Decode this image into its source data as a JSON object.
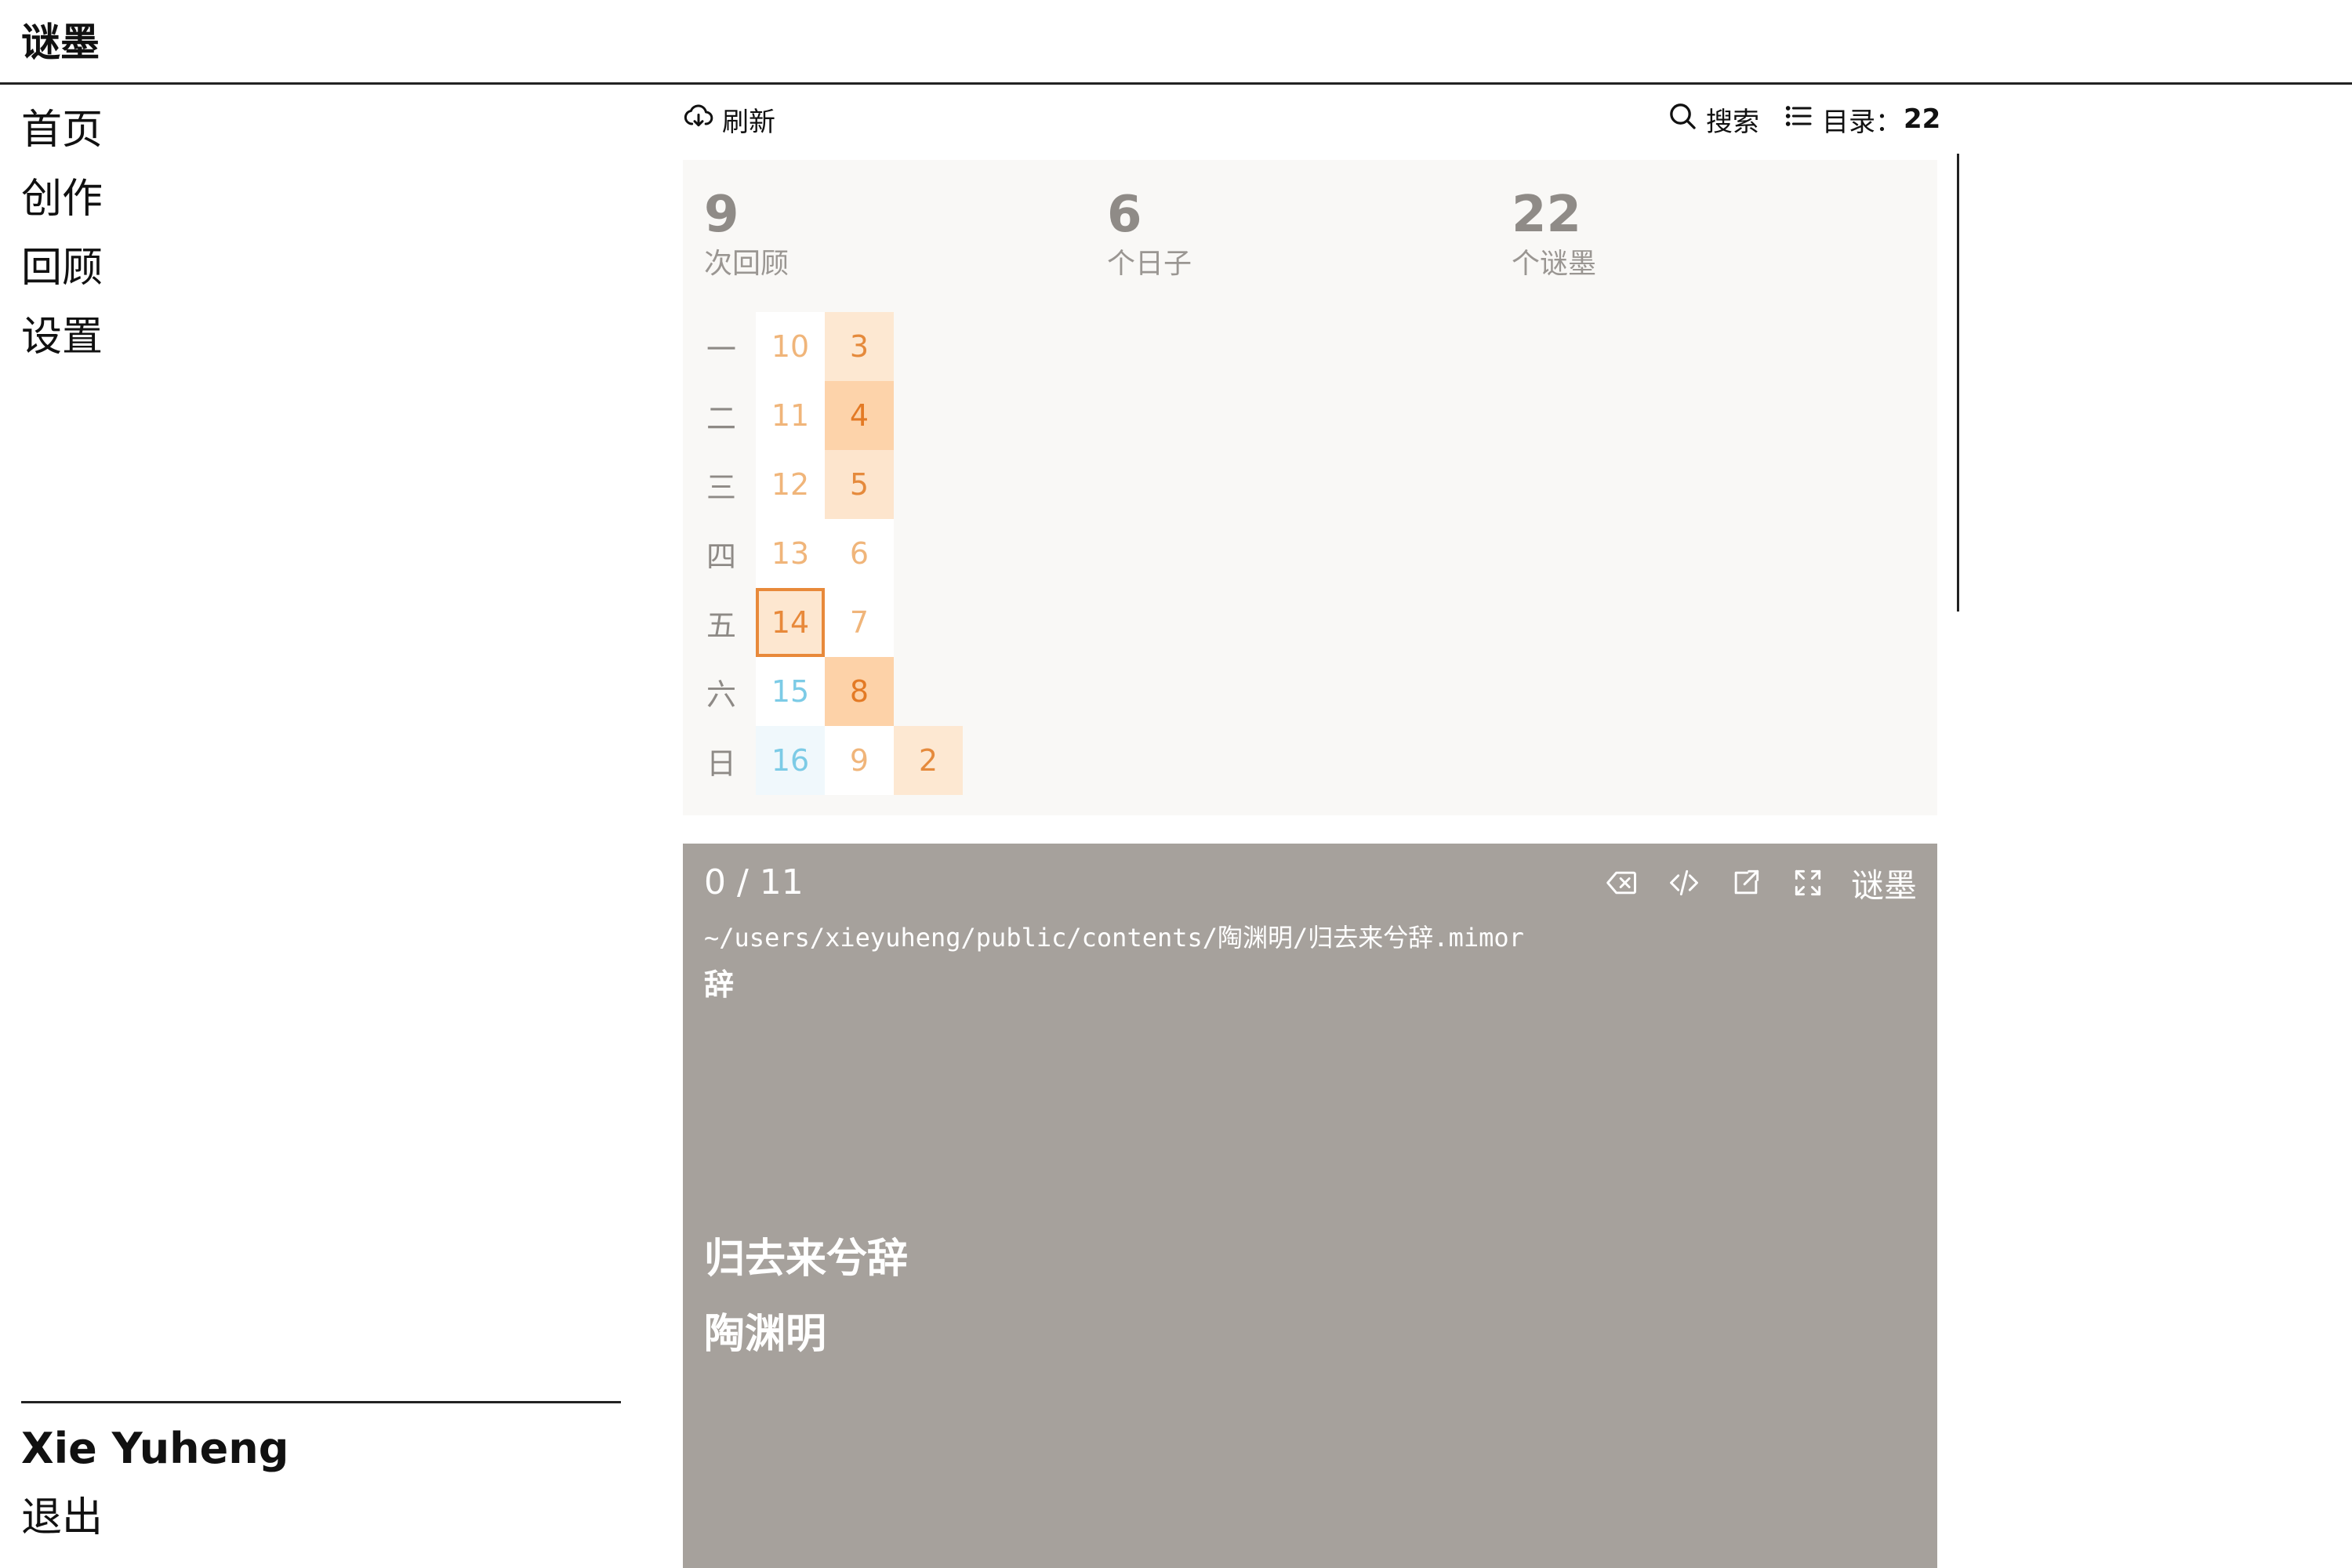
{
  "app": {
    "title": "谜墨"
  },
  "sidebar": {
    "nav": [
      {
        "label": "首页"
      },
      {
        "label": "创作"
      },
      {
        "label": "回顾"
      },
      {
        "label": "设置"
      }
    ],
    "user_name": "Xie Yuheng",
    "logout_label": "退出"
  },
  "toolbar": {
    "refresh_label": "刷新",
    "search_label": "搜索",
    "toc_label": "目录：",
    "toc_count": "22"
  },
  "stats": [
    {
      "value": "9",
      "label": "次回顾"
    },
    {
      "value": "6",
      "label": "个日子"
    },
    {
      "value": "22",
      "label": "个谜墨"
    }
  ],
  "calendar": {
    "weekdays": [
      "一",
      "二",
      "三",
      "四",
      "五",
      "六",
      "日"
    ],
    "columns": [
      {
        "cells": [
          {
            "day": "10",
            "level": 0,
            "text_color": "#f0b57a",
            "bg": "#ffffff"
          },
          {
            "day": "11",
            "level": 0,
            "text_color": "#f0b57a",
            "bg": "#ffffff"
          },
          {
            "day": "12",
            "level": 0,
            "text_color": "#f0b57a",
            "bg": "#ffffff"
          },
          {
            "day": "13",
            "level": 0,
            "text_color": "#f0b57a",
            "bg": "#ffffff"
          },
          {
            "day": "14",
            "level": 1,
            "text_color": "#e8893a",
            "bg": "#fde7d0",
            "today": true
          },
          {
            "day": "15",
            "level": 0,
            "text_color": "#7ccbe6",
            "bg": "#ffffff"
          },
          {
            "day": "16",
            "level": 0,
            "text_color": "#7ccbe6",
            "bg": "#f0f8fc"
          }
        ]
      },
      {
        "cells": [
          {
            "day": "3",
            "level": 1,
            "text_color": "#e58a3c",
            "bg": "#fde8d2"
          },
          {
            "day": "4",
            "level": 2,
            "text_color": "#e37a25",
            "bg": "#fdd3aa"
          },
          {
            "day": "5",
            "level": 1,
            "text_color": "#e58a3c",
            "bg": "#fde5cd"
          },
          {
            "day": "6",
            "level": 0,
            "text_color": "#f0b57a",
            "bg": "#ffffff"
          },
          {
            "day": "7",
            "level": 0,
            "text_color": "#f0b57a",
            "bg": "#ffffff"
          },
          {
            "day": "8",
            "level": 2,
            "text_color": "#e37a25",
            "bg": "#fdd2a8"
          },
          {
            "day": "9",
            "level": 0,
            "text_color": "#f0b57a",
            "bg": "#ffffff"
          }
        ]
      },
      {
        "cells": [
          {
            "day": "2",
            "level": 1,
            "text_color": "#e58a3c",
            "bg": "#fde8d2",
            "row": 6
          }
        ]
      }
    ],
    "today_border_color": "#e8893a"
  },
  "card": {
    "progress": "0 / 11",
    "brand_label": "谜墨",
    "path": "~/users/xieyuheng/public/contents/陶渊明/归去来兮辞.mimor",
    "heading": "辞",
    "poem_title": "归去来兮辞",
    "poem_author": "陶渊明",
    "background": "#a6a19c",
    "tools": [
      "backspace-icon",
      "code-icon",
      "external-link-icon",
      "fullscreen-icon"
    ]
  }
}
